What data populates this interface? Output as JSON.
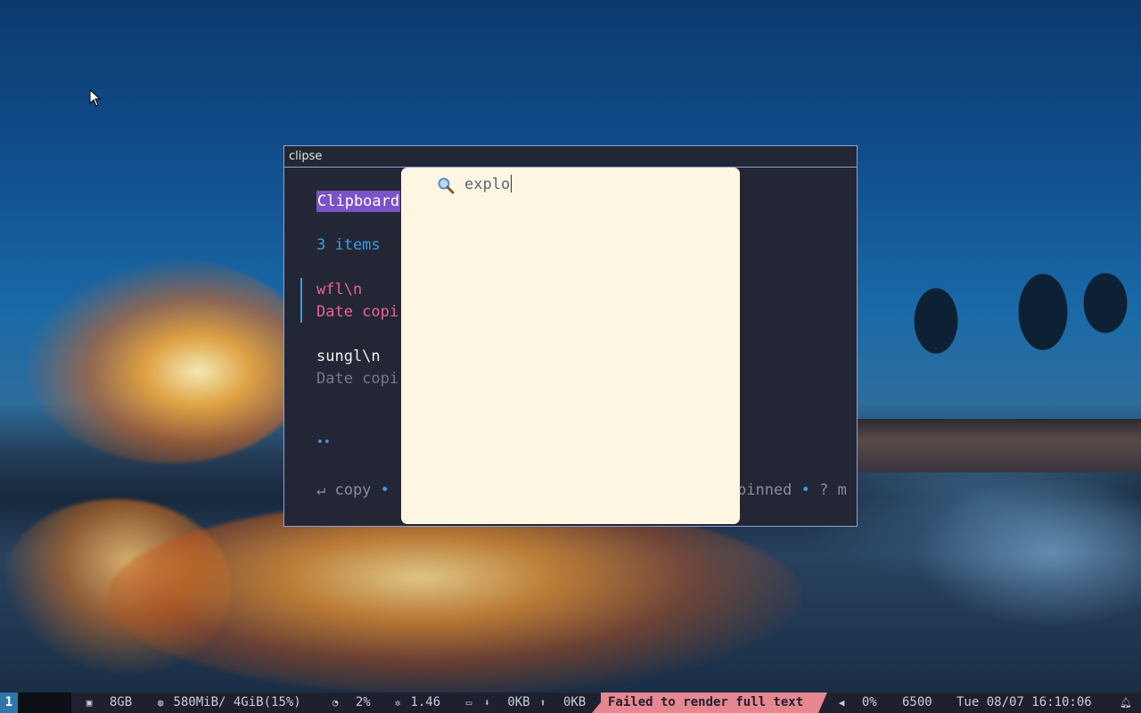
{
  "window": {
    "title": "clipse",
    "header": "Clipboard",
    "item_count": "3 items",
    "items": [
      {
        "title": "wfl\\n",
        "subtitle": "Date copi"
      },
      {
        "title": "sungl\\n",
        "subtitle": "Date copi"
      }
    ],
    "pager_dots": "••",
    "help_left": {
      "key": "↵ copy",
      "sep": "•"
    },
    "help_right": {
      "text": "pinned",
      "sep": "•",
      "more": "? m"
    }
  },
  "search": {
    "value": "explo",
    "icon": "search-icon"
  },
  "statusbar": {
    "workspace": "1",
    "disk": "8GB",
    "memory": "580MiB/ 4GiB(15%)",
    "cpu": "2%",
    "load": "1.46",
    "net_down": "0KB",
    "net_up": "0KB",
    "alert": "Failed to render full text",
    "volume": "0%",
    "temperature": "6500",
    "datetime": "Tue 08/07 16:10:06",
    "colors": {
      "workspace_bg": "#2f77a8",
      "alert_bg": "#e88790",
      "bar_bg": "#1e2030"
    }
  },
  "colors": {
    "accent_blue": "#3b9ee8",
    "selection_pink": "#f0609a",
    "header_purple": "#7b52c8",
    "popup_bg": "#fdf6e3",
    "terminal_bg": "#232634"
  }
}
